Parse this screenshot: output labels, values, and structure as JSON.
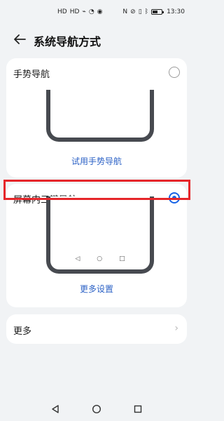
{
  "status_bar": {
    "left_indicators": [
      "HD",
      "HD",
      "⌁",
      "◔",
      "◉"
    ],
    "right_indicators": [
      "NFC",
      "mute",
      "vibrate",
      "bluetooth"
    ],
    "battery_percent": 55,
    "time": "13:30"
  },
  "header": {
    "title": "系统导航方式"
  },
  "options": {
    "gesture": {
      "label": "手势导航",
      "selected": false,
      "action_label": "试用手势导航"
    },
    "three_key": {
      "label": "屏幕内三键导航",
      "selected": true,
      "action_label": "更多设置",
      "preview_keys": [
        "◁",
        "○",
        "□"
      ]
    }
  },
  "more": {
    "label": "更多"
  },
  "system_nav": {
    "back": "back-icon",
    "home": "home-icon",
    "recents": "recents-icon"
  },
  "colors": {
    "accent": "#1763e6",
    "highlight": "#e6262a",
    "background": "#f1f3f5"
  }
}
